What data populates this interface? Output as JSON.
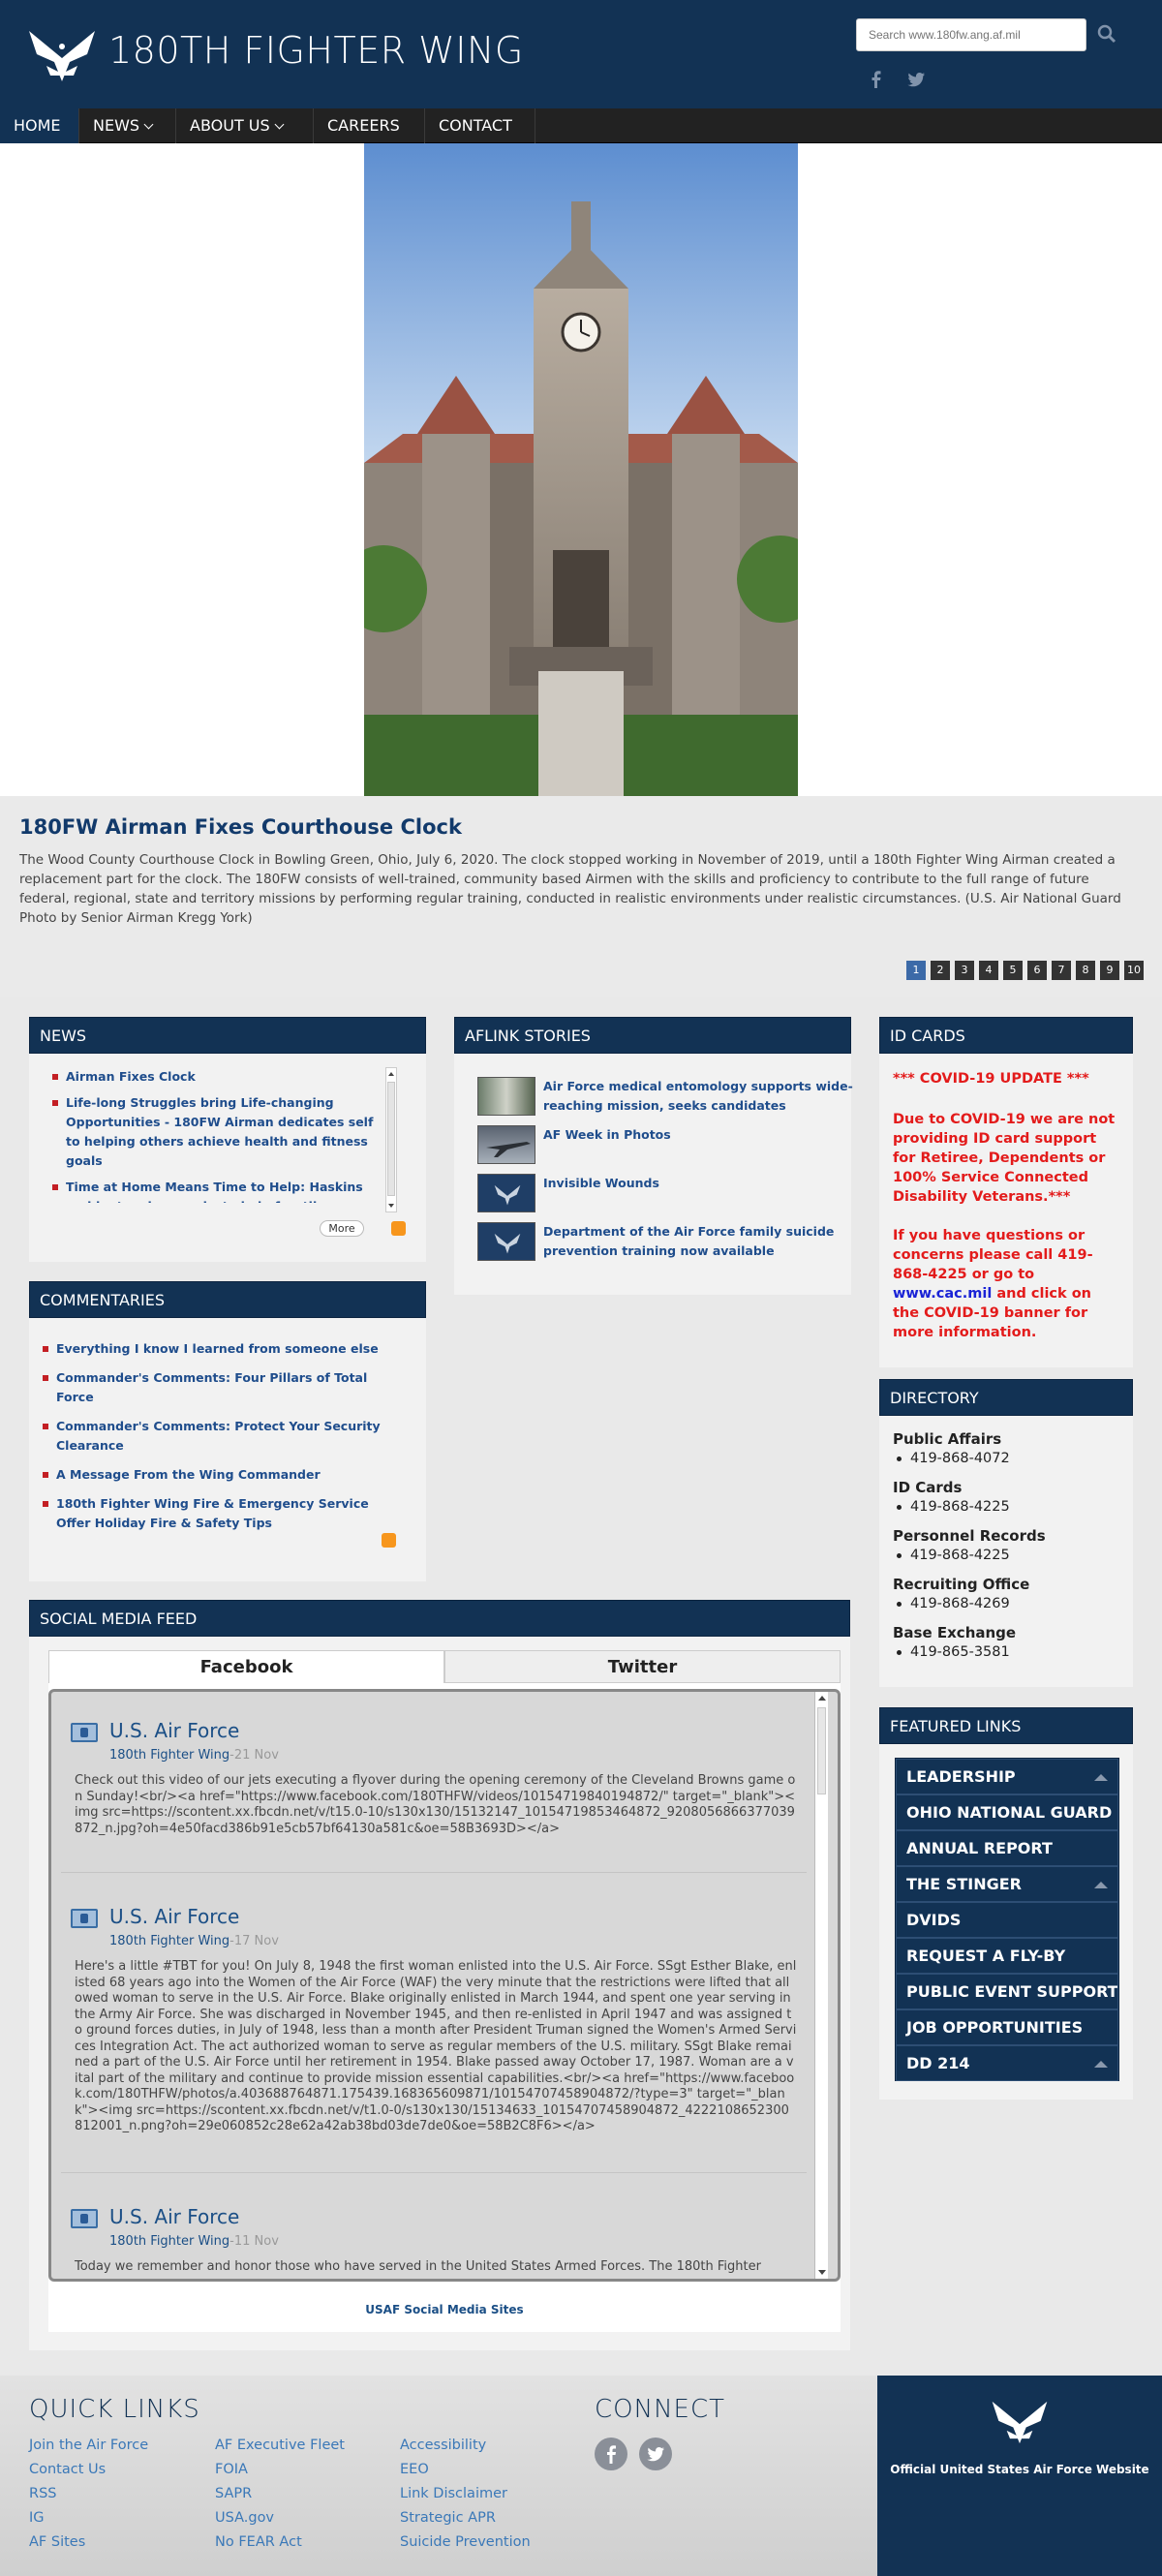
{
  "header": {
    "site_title": "180TH FIGHTER WING",
    "search_placeholder": "Search www.180fw.ang.af.mil"
  },
  "nav": {
    "items": [
      {
        "label": "HOME"
      },
      {
        "label": "NEWS"
      },
      {
        "label": "ABOUT US"
      },
      {
        "label": "CAREERS"
      },
      {
        "label": "CONTACT"
      }
    ]
  },
  "hero": {
    "title": "180FW Airman Fixes Courthouse Clock",
    "caption": "The Wood County Courthouse Clock in Bowling Green, Ohio, July 6, 2020. The clock stopped working in November of 2019, until a 180th Fighter Wing Airman created a replacement part for the clock. The 180FW consists of well-trained, community based Airmen with the skills and proficiency to contribute to the full range of future federal, regional, state and territory missions by performing regular training, conducted in realistic environments under realistic circumstances. (U.S. Air National Guard Photo by Senior Airman Kregg York)",
    "pages": [
      "1",
      "2",
      "3",
      "4",
      "5",
      "6",
      "7",
      "8",
      "9",
      "10"
    ],
    "active_page": "1"
  },
  "news": {
    "heading": "NEWS",
    "items": [
      "Airman Fixes Clock",
      "Life-long Struggles bring Life-changing Opportunities - 180FW Airman dedicates self to helping others achieve health and fitness goals",
      "Time at Home Means Time to Help: Haskins resident makes masks to help frontline workers during COVID-19 pandemic"
    ],
    "more_label": "More"
  },
  "commentaries": {
    "heading": "COMMENTARIES",
    "items": [
      "Everything I know I learned from someone else",
      "Commander's Comments: Four Pillars of Total Force",
      "Commander's Comments: Protect Your Security Clearance",
      "A Message From the Wing Commander",
      "180th Fighter Wing Fire & Emergency Service Offer Holiday Fire & Safety Tips"
    ]
  },
  "aflink": {
    "heading": "AFLINK STORIES",
    "stories": [
      "Air Force medical entomology supports wide-reaching mission, seeks candidates",
      "AF Week in Photos",
      "Invisible Wounds",
      "Department of the Air Force family suicide prevention training now available"
    ]
  },
  "id_cards": {
    "heading": "ID CARDS",
    "update": "*** COVID-19 UPDATE ***",
    "notice": "Due to COVID-19 we are not providing ID card support for Retiree, Dependents or 100% Service Connected Disability Veterans.***",
    "contact_before": "If you have questions or concerns please call 419-868-4225 or go to ",
    "contact_link": "www.cac.mil",
    "contact_after": " and click on the COVID-19 banner for more information."
  },
  "directory": {
    "heading": "DIRECTORY",
    "entries": [
      {
        "name": "Public Affairs",
        "phone": "419-868-4072"
      },
      {
        "name": "ID Cards",
        "phone": "419-868-4225"
      },
      {
        "name": "Personnel Records",
        "phone": "419-868-4225"
      },
      {
        "name": "Recruiting Office",
        "phone": "419-868-4269"
      },
      {
        "name": "Base Exchange",
        "phone": "419-865-3581"
      }
    ]
  },
  "featured": {
    "heading": "FEATURED LINKS",
    "links": [
      "LEADERSHIP",
      "OHIO NATIONAL GUARD",
      "ANNUAL REPORT",
      "THE STINGER",
      "DVIDS",
      "REQUEST A FLY-BY",
      "PUBLIC EVENT SUPPORT",
      "JOB OPPORTUNITIES",
      "DD 214"
    ]
  },
  "social": {
    "heading": "SOCIAL MEDIA FEED",
    "tabs": [
      "Facebook",
      "Twitter"
    ],
    "posts": [
      {
        "author": "U.S. Air Force",
        "source": "180th Fighter Wing",
        "ago": "-21 Nov",
        "text": "Check out this video of our jets executing a flyover during the opening ceremony of the Cleveland Browns game on Sunday!<br/><a href=\"https://www.facebook.com/180THFW/videos/10154719840194872/\" target=\"_blank\"><img src=https://scontent.xx.fbcdn.net/v/t15.0-10/s130x130/15132147_10154719853464872_9208056866377039872_n.jpg?oh=4e50facd386b91e5cb57bf64130a581c&oe=58B3693D></a>"
      },
      {
        "author": "U.S. Air Force",
        "source": "180th Fighter Wing",
        "ago": "-17 Nov",
        "text": "Here's a little #TBT for you! On July 8, 1948 the first woman enlisted into the U.S. Air Force. SSgt Esther Blake, enlisted 68 years ago into the Women of the Air Force (WAF) the very minute that the restrictions were lifted that allowed woman to serve in the U.S. Air Force. Blake originally enlisted in March 1944, and spent one year serving in the Army Air Force. She was discharged in November 1945, and then re-enlisted in April 1947 and was assigned to ground forces duties, in July of 1948, less than a month after President Truman signed the Women's Armed Services Integration Act. The act authorized woman to serve as regular members of the U.S. military. SSgt Blake remained a part of the U.S. Air Force until her retirement in 1954. Blake passed away October 17, 1987. Woman are a vital part of the military and continue to provide mission essential capabilities.<br/><a href=\"https://www.facebook.com/180THFW/photos/a.403688764871.175439.168365609871/10154707458904872/?type=3\" target=\"_blank\"><img src=https://scontent.xx.fbcdn.net/v/t1.0-0/s130x130/15134633_10154707458904872_4222108652300812001_n.png?oh=29e060852c28e62a42ab38bd03de7de0&oe=58B2C8F6></a>"
      },
      {
        "author": "U.S. Air Force",
        "source": "180th Fighter Wing",
        "ago": "-11 Nov",
        "text": "Today we remember and honor those who have served in the United States Armed Forces. The 180th Fighter"
      }
    ],
    "footer_link": "USAF Social Media Sites"
  },
  "footer": {
    "quick_links_heading": "QUICK LINKS",
    "quick_links": [
      [
        "Join the Air Force",
        "AF Executive Fleet",
        "Accessibility"
      ],
      [
        "Contact Us",
        "FOIA",
        "EEO"
      ],
      [
        "RSS",
        "SAPR",
        "Link Disclaimer"
      ],
      [
        "IG",
        "USA.gov",
        "Strategic APR"
      ],
      [
        "AF Sites",
        "No FEAR Act",
        "Suicide Prevention"
      ]
    ],
    "connect_heading": "CONNECT",
    "af_site_label": "Official United States Air Force Website"
  },
  "colors": {
    "brand_navy": "#123254",
    "nav_dark": "#222222",
    "alert_red": "#e31b1b",
    "link_blue": "#1f4d8c"
  },
  "icons": [
    "air-force-logo-icon",
    "search-icon",
    "facebook-icon",
    "twitter-icon",
    "rss-icon",
    "chevron-down-icon",
    "scroll-up-icon",
    "scroll-down-icon"
  ]
}
